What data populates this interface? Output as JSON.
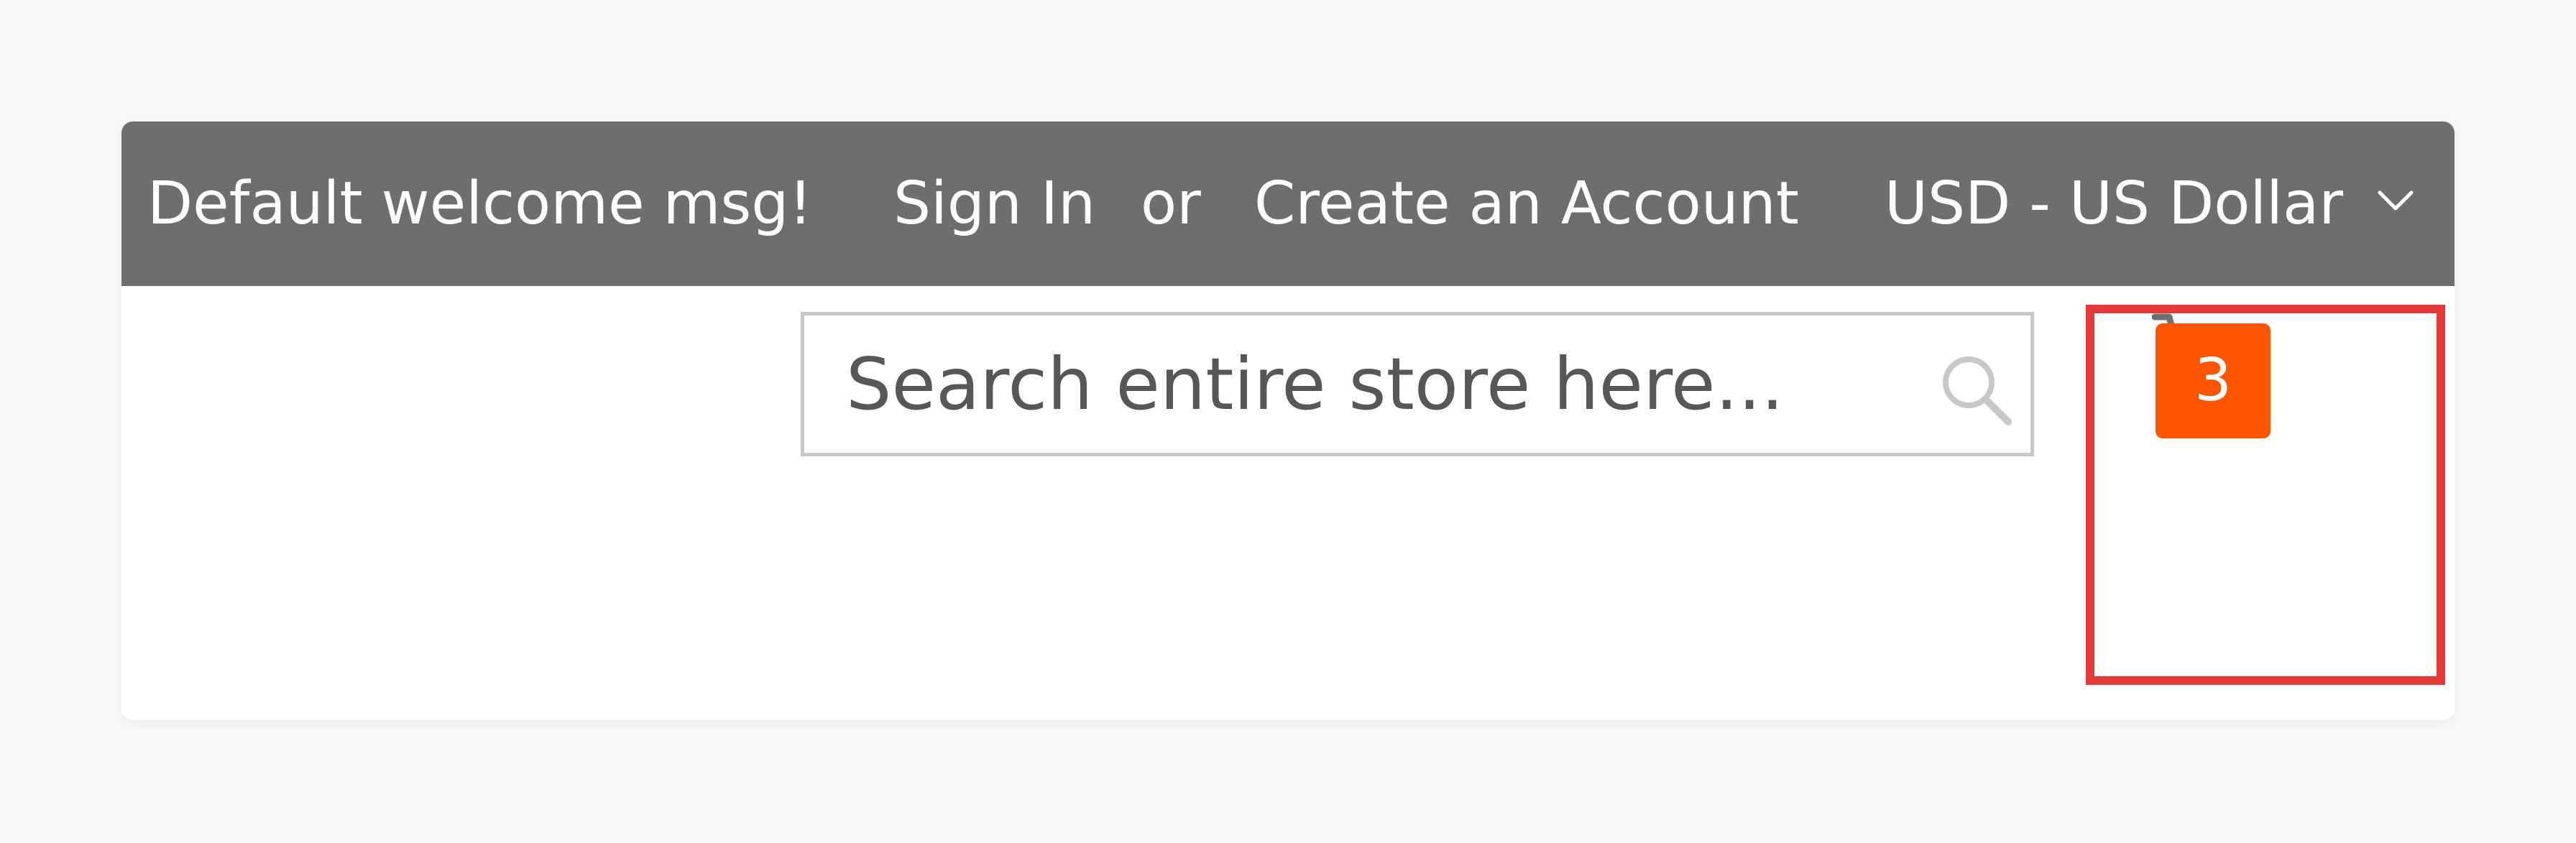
{
  "header": {
    "welcome_text": "Default welcome msg!",
    "sign_in_label": "Sign In",
    "or_text": "or",
    "create_account_label": "Create an Account",
    "currency_label": "USD - US Dollar",
    "currency_icon": "chevron-down-icon"
  },
  "search": {
    "placeholder": "Search entire store here...",
    "value": "",
    "icon": "search-icon"
  },
  "minicart": {
    "icon": "cart-icon",
    "count": "3",
    "badge_color": "#ff5501"
  },
  "colors": {
    "topbar_background": "#6e6f6d",
    "highlight_border": "#e53935"
  }
}
